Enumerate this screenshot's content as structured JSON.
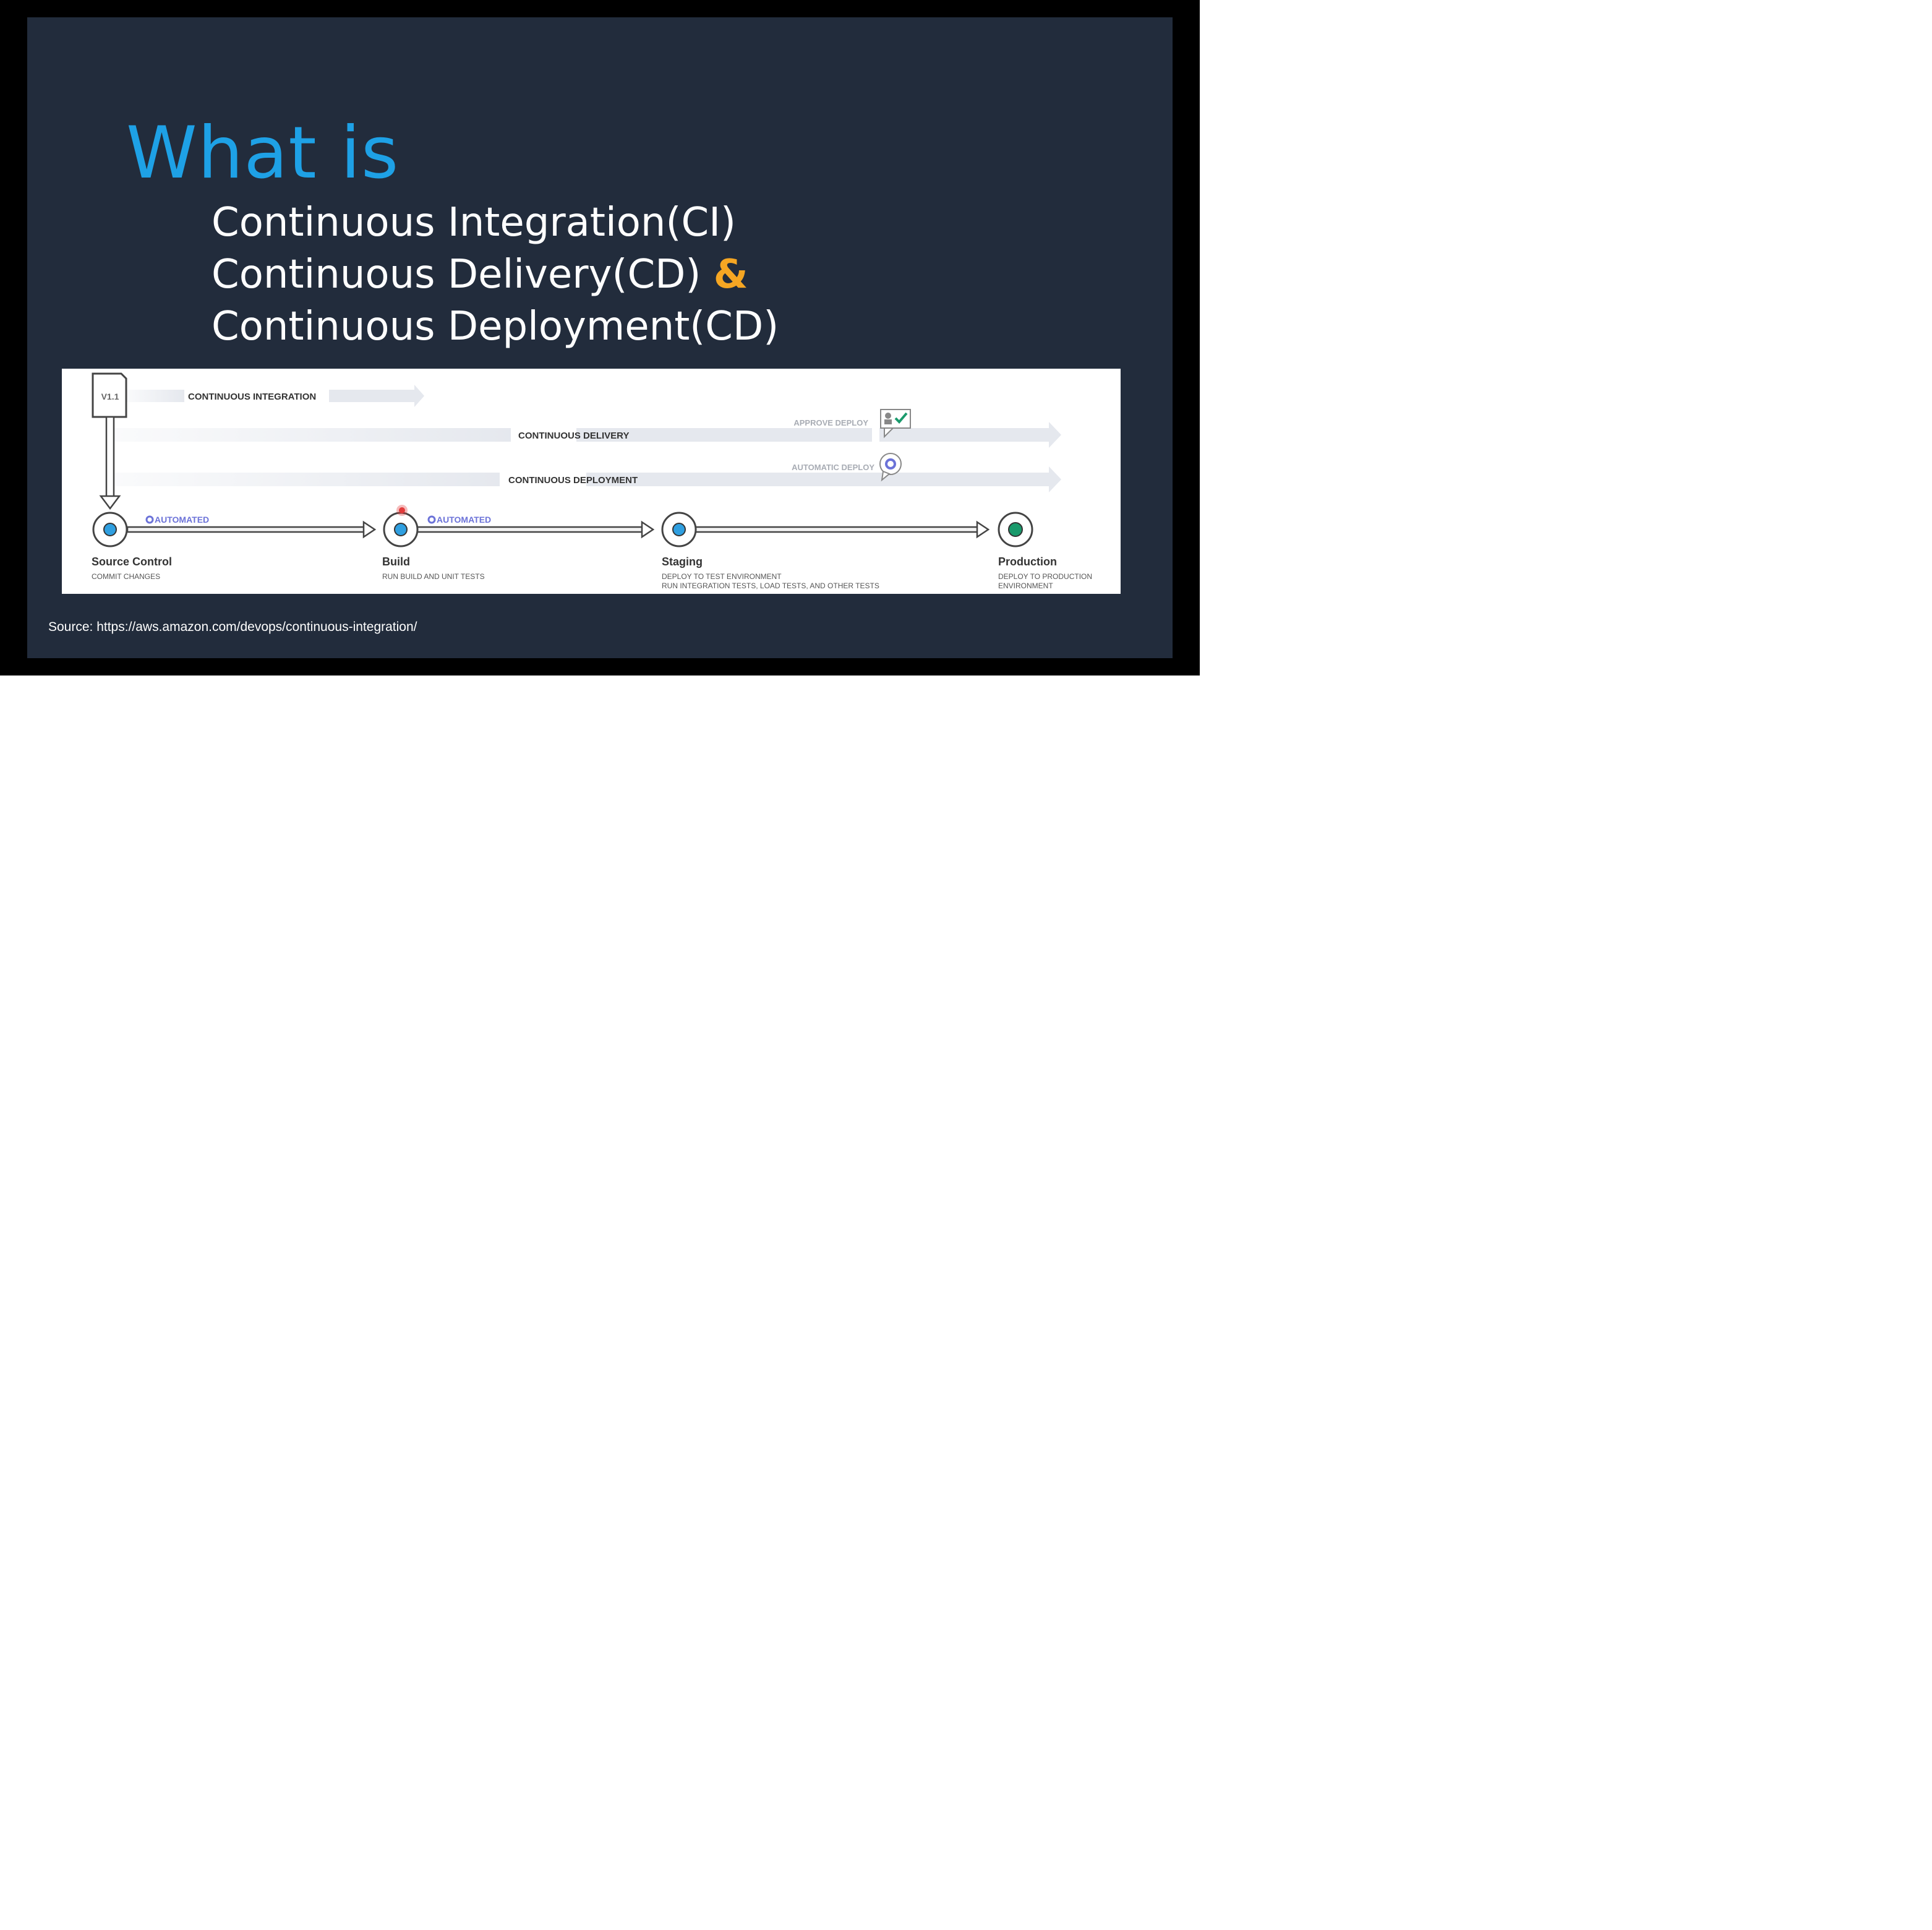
{
  "slide": {
    "title": "What is",
    "lines": [
      "Continuous Integration(CI)",
      "Continuous Delivery(CD)",
      "Continuous Deployment(CD)"
    ],
    "ampersand": "&",
    "source": "Source: https://aws.amazon.com/devops/continuous-integration/"
  },
  "diagram": {
    "version_label": "V1.1",
    "bands": {
      "integration": "CONTINUOUS INTEGRATION",
      "delivery": "CONTINUOUS DELIVERY",
      "deployment": "CONTINUOUS DEPLOYMENT"
    },
    "approve_deploy": "APPROVE DEPLOY",
    "automatic_deploy": "AUTOMATIC DEPLOY",
    "automated_label": "AUTOMATED",
    "stages": [
      {
        "name": "Source Control",
        "desc": [
          "COMMIT CHANGES"
        ]
      },
      {
        "name": "Build",
        "desc": [
          "RUN BUILD AND UNIT TESTS"
        ]
      },
      {
        "name": "Staging",
        "desc": [
          "DEPLOY TO TEST ENVIRONMENT",
          "RUN INTEGRATION TESTS, LOAD TESTS, AND OTHER TESTS"
        ]
      },
      {
        "name": "Production",
        "desc": [
          "DEPLOY TO PRODUCTION",
          "ENVIRONMENT"
        ]
      }
    ],
    "colors": {
      "band": "#e5e8ee",
      "stage_dot": "#2f9fe0",
      "production_dot": "#1a9a6c",
      "automated": "#6b72d8",
      "alert": "#e23b3b"
    }
  }
}
